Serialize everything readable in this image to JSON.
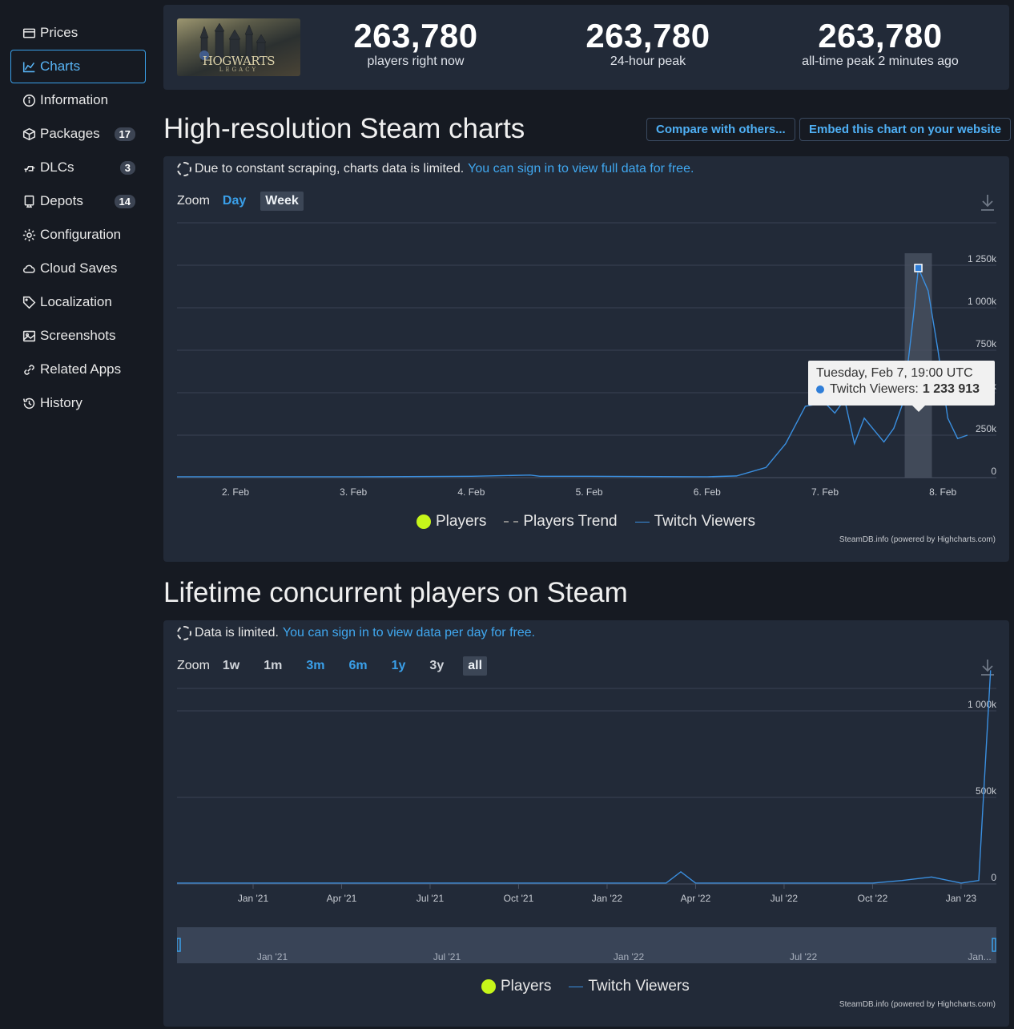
{
  "sidebar": {
    "items": [
      {
        "label": "Prices",
        "icon": "card-icon",
        "badge": ""
      },
      {
        "label": "Charts",
        "icon": "chart-icon",
        "badge": "",
        "active": true
      },
      {
        "label": "Information",
        "icon": "info-icon",
        "badge": ""
      },
      {
        "label": "Packages",
        "icon": "package-icon",
        "badge": "17"
      },
      {
        "label": "DLCs",
        "icon": "plug-icon",
        "badge": "3"
      },
      {
        "label": "Depots",
        "icon": "depot-icon",
        "badge": "14"
      },
      {
        "label": "Configuration",
        "icon": "gear-icon",
        "badge": ""
      },
      {
        "label": "Cloud Saves",
        "icon": "cloud-icon",
        "badge": ""
      },
      {
        "label": "Localization",
        "icon": "tag-icon",
        "badge": ""
      },
      {
        "label": "Screenshots",
        "icon": "image-icon",
        "badge": ""
      },
      {
        "label": "Related Apps",
        "icon": "link-icon",
        "badge": ""
      },
      {
        "label": "History",
        "icon": "history-icon",
        "badge": ""
      }
    ]
  },
  "header": {
    "logo_text": "HOGWARTS",
    "logo_sub": "LEGACY",
    "stats": [
      {
        "value": "263,780",
        "label": "players right now"
      },
      {
        "value": "263,780",
        "label": "24-hour peak"
      },
      {
        "value": "263,780",
        "label": "all-time peak 2 minutes ago"
      }
    ]
  },
  "section1": {
    "title": "High-resolution Steam charts",
    "compare_button": "Compare with others...",
    "embed_button": "Embed this chart on your website",
    "notice": "Due to constant scraping, charts data is limited.",
    "notice_link": "You can sign in to view full data for free.",
    "zoom_label": "Zoom",
    "zoom_options": [
      "Day",
      "Week"
    ],
    "zoom_selected": "Week",
    "tooltip_date": "Tuesday, Feb 7, 19:00 UTC",
    "tooltip_series": "Twitch Viewers:",
    "tooltip_value": "1 233 913",
    "legend": [
      "Players",
      "Players Trend",
      "Twitch Viewers"
    ],
    "credits": "SteamDB.info (powered by Highcharts.com)"
  },
  "section2": {
    "title": "Lifetime concurrent players on Steam",
    "notice": "Data is limited.",
    "notice_link": "You can sign in to view data per day for free.",
    "zoom_label": "Zoom",
    "zoom_options": [
      "1w",
      "1m",
      "3m",
      "6m",
      "1y",
      "3y",
      "all"
    ],
    "zoom_selected": "all",
    "legend": [
      "Players",
      "Twitch Viewers"
    ],
    "credits": "SteamDB.info (powered by Highcharts.com)",
    "navigator_labels": [
      "Jan '21",
      "Jul '21",
      "Jan '22",
      "Jul '22",
      "Jan..."
    ]
  },
  "chart_data": [
    {
      "type": "line",
      "x_ticks": [
        "2. Feb",
        "3. Feb",
        "4. Feb",
        "5. Feb",
        "6. Feb",
        "7. Feb",
        "8. Feb"
      ],
      "y_ticks": [
        "0",
        "250k",
        "500k",
        "750k",
        "1 000k",
        "1 250k"
      ],
      "ylim": [
        0,
        1500000
      ],
      "series": [
        {
          "name": "Twitch Viewers",
          "color": "#3a8fe0",
          "x": [
            "2. Feb",
            "3. Feb",
            "4. Feb",
            "4. Feb 12:00",
            "4. Feb 14:00",
            "5. Feb",
            "6. Feb",
            "6. Feb 06:00",
            "6. Feb 12:00",
            "6. Feb 16:00",
            "6. Feb 20:00",
            "7. Feb",
            "7. Feb 02:00",
            "7. Feb 04:00",
            "7. Feb 06:00",
            "7. Feb 08:00",
            "7. Feb 10:00",
            "7. Feb 12:00",
            "7. Feb 14:00",
            "7. Feb 16:00",
            "7. Feb 18:00",
            "7. Feb 19:00",
            "7. Feb 21:00",
            "7. Feb 23:00",
            "8. Feb 01:00",
            "8. Feb 03:00",
            "8. Feb 05:00"
          ],
          "values": [
            5000,
            5000,
            8000,
            15000,
            8000,
            8000,
            5000,
            10000,
            60000,
            200000,
            420000,
            440000,
            380000,
            460000,
            200000,
            350000,
            280000,
            210000,
            290000,
            450000,
            950000,
            1233913,
            1100000,
            750000,
            350000,
            230000,
            250000
          ]
        }
      ],
      "tooltip": {
        "x": "Tuesday, Feb 7, 19:00 UTC",
        "series": "Twitch Viewers",
        "value": 1233913
      }
    },
    {
      "type": "line",
      "x_ticks": [
        "Jan '21",
        "Apr '21",
        "Jul '21",
        "Oct '21",
        "Jan '22",
        "Apr '22",
        "Jul '22",
        "Oct '22",
        "Jan '23"
      ],
      "y_ticks": [
        "0",
        "500k",
        "1 000k"
      ],
      "ylim": [
        0,
        1500000
      ],
      "series": [
        {
          "name": "Twitch Viewers",
          "color": "#3a8fe0",
          "x": [
            "Nov '20",
            "Jan '21",
            "Apr '21",
            "Jul '21",
            "Oct '21",
            "Jan '22",
            "Mar '22",
            "Mar '22 (peak)",
            "Apr '22",
            "Jul '22",
            "Oct '22",
            "Nov '22",
            "Dec '22",
            "Jan '23",
            "Jan '23 (late)",
            "Feb '23"
          ],
          "values": [
            5000,
            5000,
            5000,
            5000,
            5000,
            5000,
            5000,
            70000,
            5000,
            5000,
            5000,
            20000,
            40000,
            5000,
            20000,
            1233913
          ]
        }
      ]
    }
  ]
}
